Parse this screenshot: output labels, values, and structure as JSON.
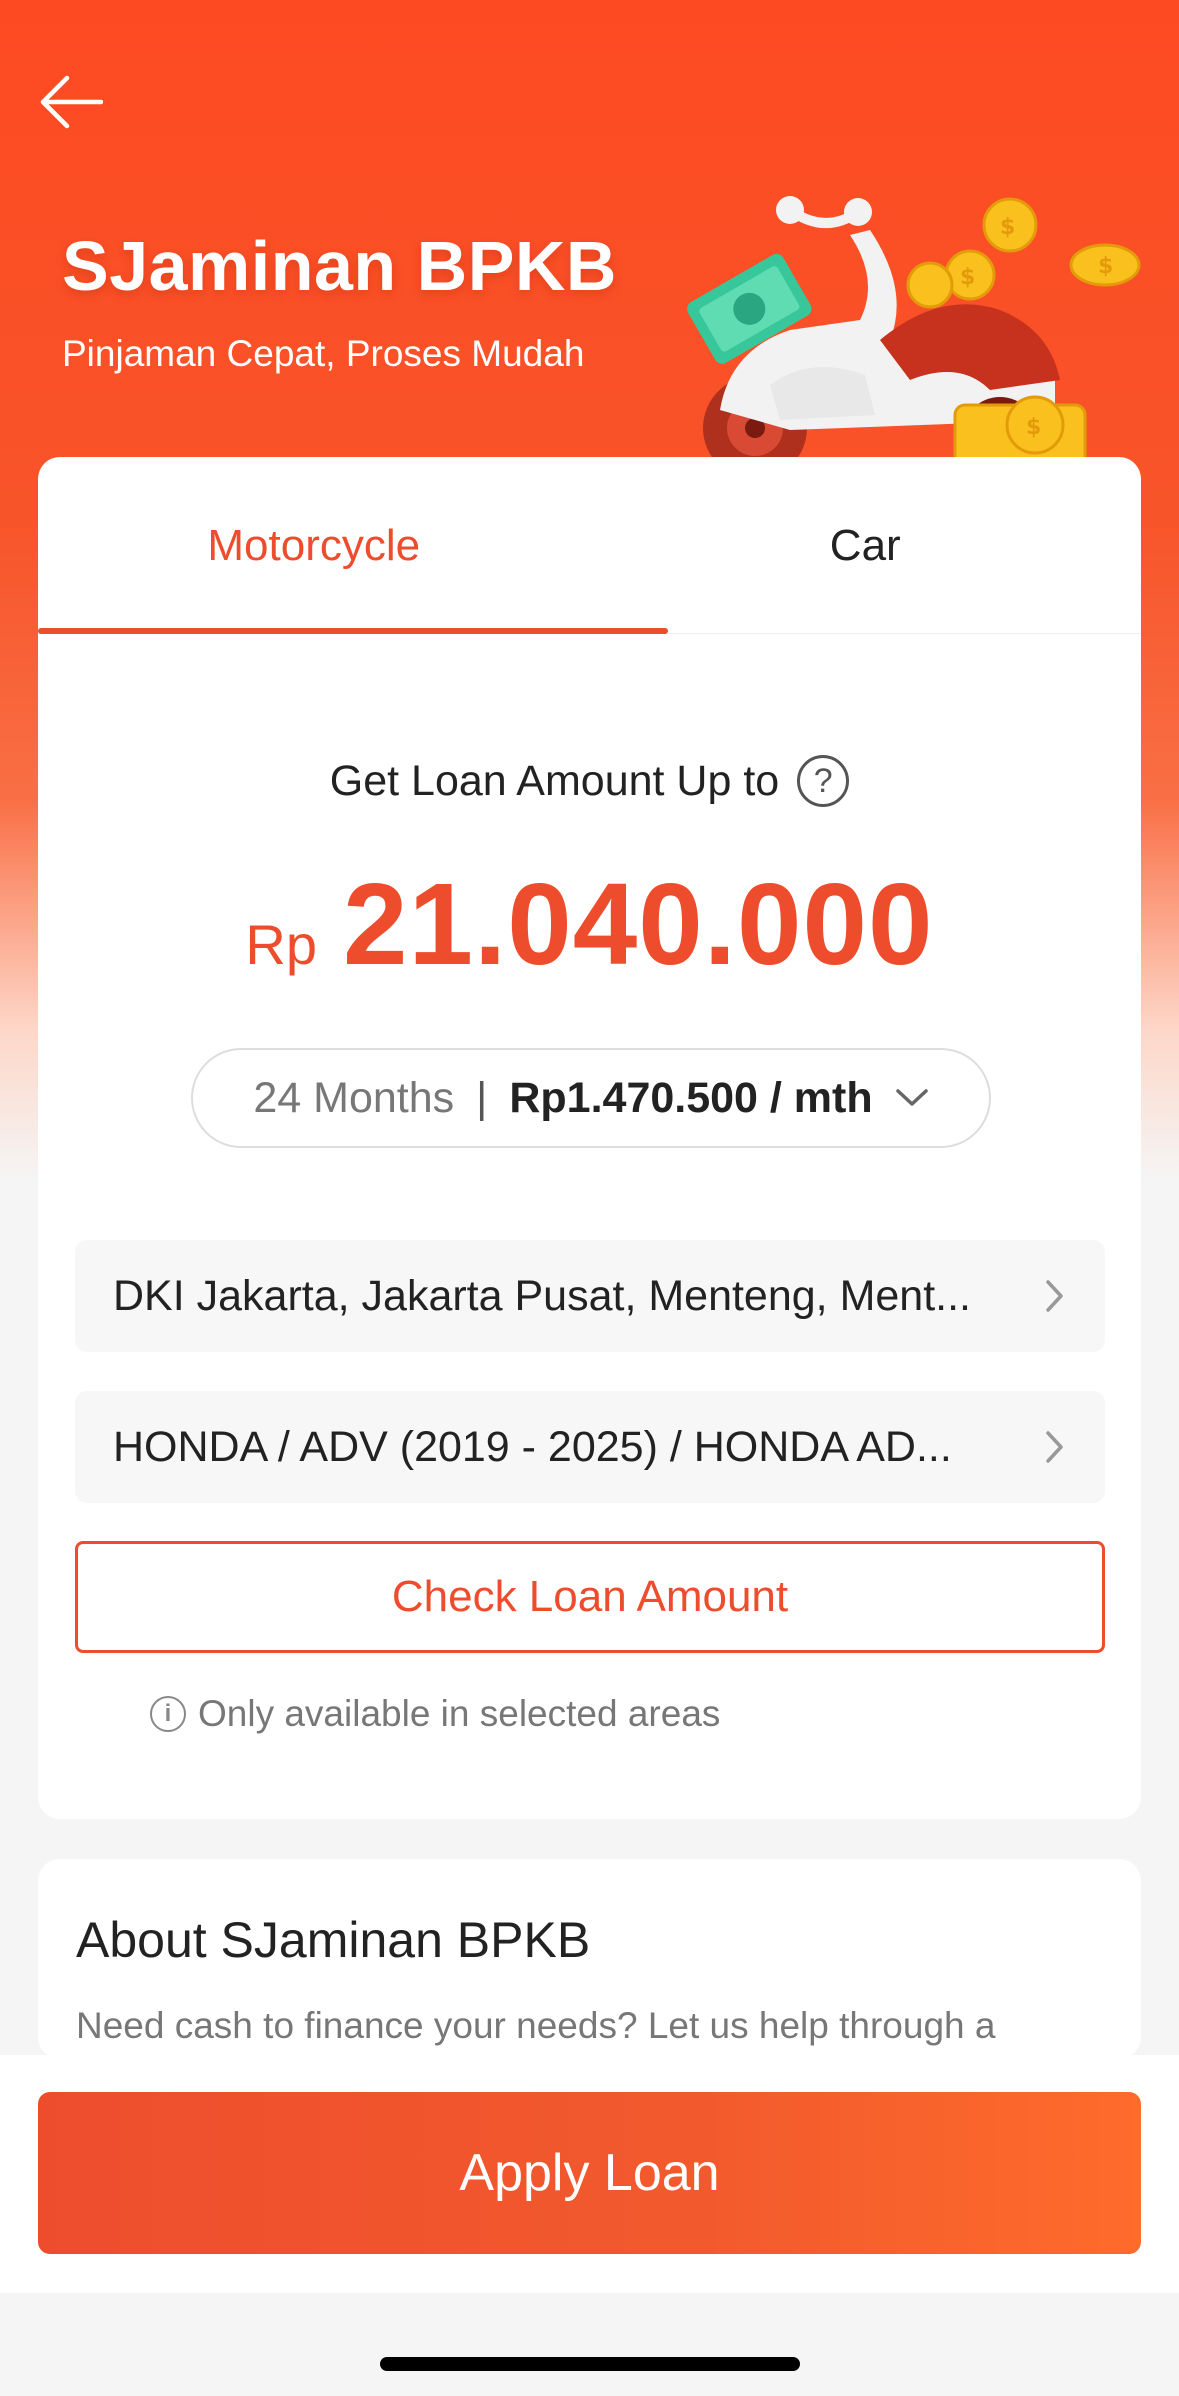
{
  "header": {
    "title": "SJaminan BPKB",
    "subtitle": "Pinjaman Cepat, Proses Mudah",
    "back_icon": "arrow-left-icon",
    "illustration": "scooter-with-coins-illustration"
  },
  "tabs": [
    {
      "label": "Motorcycle",
      "active": true
    },
    {
      "label": "Car",
      "active": false
    }
  ],
  "loan": {
    "label": "Get Loan Amount Up to",
    "help_icon": "question-circle-icon",
    "currency": "Rp",
    "amount": "21.040.000"
  },
  "tenor": {
    "months": "24 Months",
    "separator": "|",
    "monthly": "Rp1.470.500 / mth",
    "icon": "chevron-down-icon"
  },
  "location": {
    "value": "DKI Jakarta, Jakarta Pusat, Menteng, Ment...",
    "icon": "chevron-right-icon"
  },
  "vehicle": {
    "value": "HONDA / ADV (2019 - 2025) / HONDA AD...",
    "icon": "chevron-right-icon"
  },
  "check_button": "Check Loan Amount",
  "note": {
    "icon": "info-icon",
    "icon_glyph": "i",
    "text": "Only available in selected areas"
  },
  "about": {
    "title": "About SJaminan BPKB",
    "description": "Need cash to finance your needs? Let us help through a"
  },
  "apply_button": "Apply Loan",
  "colors": {
    "brand": "#ee4d2d",
    "header_bg": "#fe4a22",
    "text": "#222222",
    "muted": "#777777"
  }
}
